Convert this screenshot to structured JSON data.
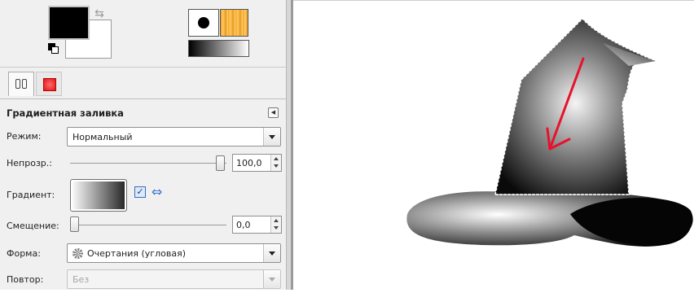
{
  "panel": {
    "section_title": "Градиентная заливка",
    "mode": {
      "label": "Режим:",
      "value": "Нормальный"
    },
    "opacity": {
      "label": "Непрозр.:",
      "value": "100,0"
    },
    "gradient": {
      "label": "Градиент:",
      "reverse_checked": true
    },
    "offset": {
      "label": "Смещение:",
      "value": "0,0"
    },
    "shape": {
      "label": "Форма:",
      "value": "Очертания (угловая)"
    },
    "repeat": {
      "label": "Повтор:",
      "value": "Без"
    }
  },
  "colors": {
    "foreground": "#000000",
    "background": "#ffffff",
    "arrow": "#e8112d"
  },
  "icons": [
    "swap-colors-icon",
    "reset-colors-icon",
    "brush-preview-icon",
    "pattern-preview-icon",
    "gradient-preview-icon",
    "tool-options-icon",
    "red-tab-icon",
    "tab-menu-icon",
    "shape-angular-icon",
    "reverse-gradient-icon"
  ]
}
